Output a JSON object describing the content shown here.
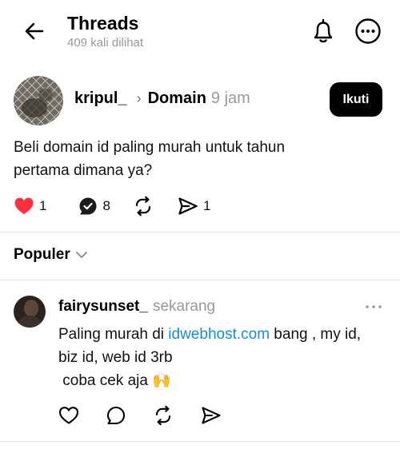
{
  "header": {
    "title": "Threads",
    "views": "409 kali dilihat"
  },
  "post": {
    "username": "kripul_",
    "topic": "Domain",
    "time": "9 jam",
    "follow_label": "Ikuti",
    "text_line1": "Beli domain id paling murah untuk tahun",
    "text_line2": "pertama dimana ya?",
    "likes": "1",
    "replies": "8",
    "shares": "1",
    "like_color": "#ff3040"
  },
  "sort": {
    "label": "Populer"
  },
  "reply": {
    "username": "fairysunset_",
    "time": "sekarang",
    "text_before_link": "Paling murah di ",
    "link_text": "idwebhost.com",
    "text_after_link": " bang , my id,",
    "text_line2": "biz id, web id 3rb",
    "text_line3": " coba cek aja ",
    "emoji": "🙌"
  },
  "icons": {
    "back": "arrow-left-icon",
    "bell": "bell-icon",
    "more": "more-circle-icon",
    "like": "heart-icon",
    "reply": "reply-bubble-icon",
    "repost": "repost-icon",
    "share": "send-icon"
  }
}
